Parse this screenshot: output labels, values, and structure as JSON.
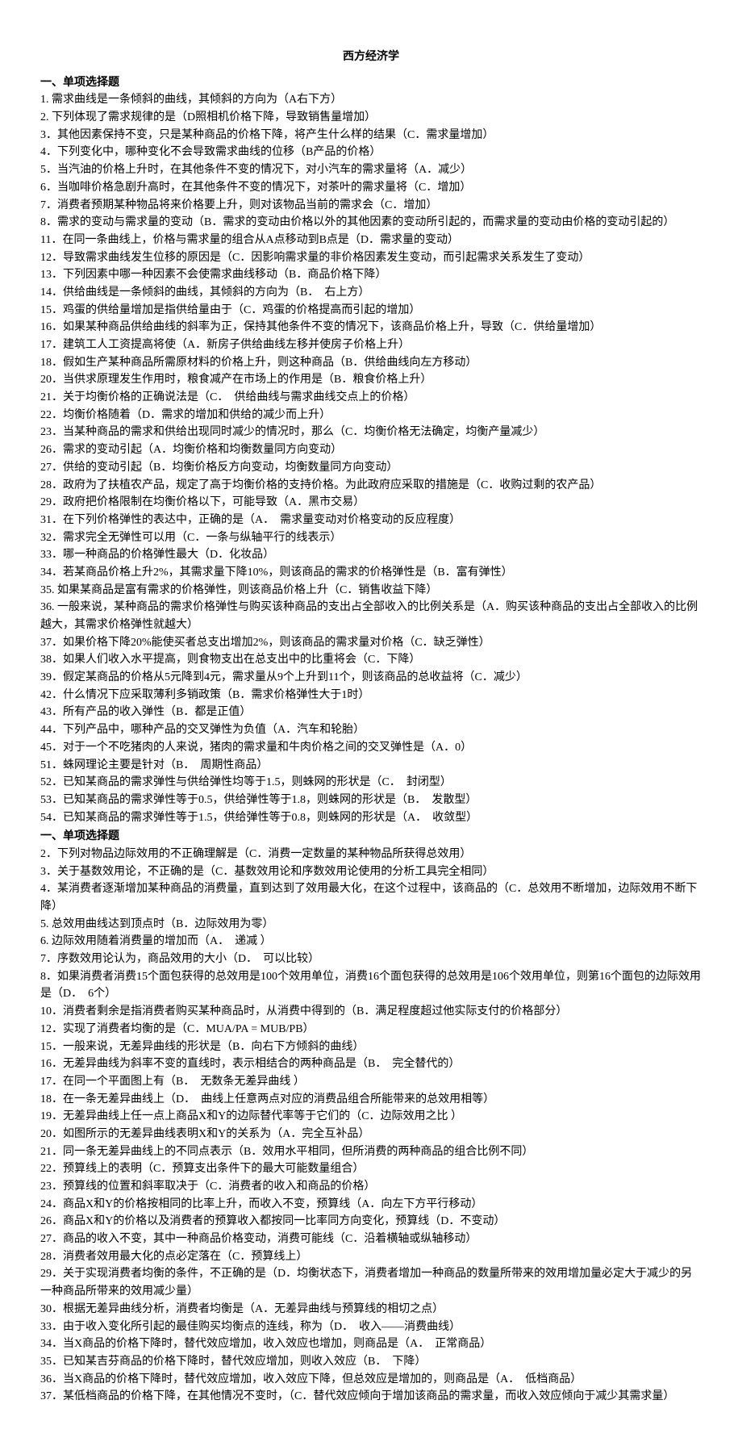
{
  "title": "西方经济学",
  "section1_heading": "一、单项选择题",
  "section1_items": [
    "1. 需求曲线是一条倾斜的曲线，其倾斜的方向为（A右下方）",
    "2. 下列体现了需求规律的是（D照相机价格下降，导致销售量增加）",
    "3．其他因素保持不变，只是某种商品的价格下降，将产生什么样的结果（C．需求量增加）",
    "4．下列变化中，哪种变化不会导致需求曲线的位移（B产品的价格）",
    "5．当汽油的价格上升时，在其他条件不变的情况下，对小汽车的需求量将（A．减少）",
    "6．当咖啡价格急剧升高时，在其他条件不变的情况下，对茶叶的需求量将（C．增加）",
    "7．消费者预期某种物品将来价格要上升，则对该物品当前的需求会（C．增加）",
    "8．需求的变动与需求量的变动（B．需求的变动由价格以外的其他因素的变动所引起的，而需求量的变动由价格的变动引起的）",
    "11．在同一条曲线上，价格与需求量的组合从A点移动到B点是（D．需求量的变动）",
    "12．导致需求曲线发生位移的原因是（C．因影响需求量的非价格因素发生变动，而引起需求关系发生了变动）",
    "13．下列因素中哪一种因素不会使需求曲线移动（B．商品价格下降）",
    "14．供给曲线是一条倾斜的曲线，其倾斜的方向为（B．　右上方）",
    "15．鸡蛋的供给量增加是指供给量由于（C．鸡蛋的价格提高而引起的增加）",
    "16．如果某种商品供给曲线的斜率为正，保持其他条件不变的情况下，该商品价格上升，导致（C．供给量增加）",
    "17．建筑工人工资提高将使（A．新房子供给曲线左移并使房子价格上升）",
    "18．假如生产某种商品所需原材料的价格上升，则这种商品（B．供给曲线向左方移动）",
    "20．当供求原理发生作用时，粮食减产在市场上的作用是（B．粮食价格上升）",
    "21．关于均衡价格的正确说法是（C．　供给曲线与需求曲线交点上的价格）",
    "22．均衡价格随着（D．需求的增加和供给的减少而上升）",
    "23．当某种商品的需求和供给出现同时减少的情况时，那么（C．均衡价格无法确定，均衡产量减少）",
    "26．需求的变动引起（A．均衡价格和均衡数量同方向变动）",
    "27．供给的变动引起（B．均衡价格反方向变动，均衡数量同方向变动）",
    "28．政府为了扶植农产品，规定了高于均衡价格的支持价格。为此政府应采取的措施是（C．收购过剩的农产品）",
    "29．政府把价格限制在均衡价格以下，可能导致（A．黑市交易）",
    "31．在下列价格弹性的表达中，正确的是（A．　需求量变动对价格变动的反应程度）",
    "32．需求完全无弹性可以用（C．一条与纵轴平行的线表示）",
    "33．哪一种商品的价格弹性最大（D．化妆品）",
    "34．若某商品价格上升2%，其需求量下降10%，则该商品的需求的价格弹性是（B．富有弹性）",
    "35. 如果某商品是富有需求的价格弹性，则该商品价格上升（C．销售收益下降）",
    "36. 一般来说，某种商品的需求价格弹性与购买该种商品的支出占全部收入的比例关系是（A．购买该种商品的支出占全部收入的比例越大，其需求价格弹性就越大）",
    "37．如果价格下降20%能使买者总支出增加2%，则该商品的需求量对价格（C．缺乏弹性）",
    "38．如果人们收入水平提高，则食物支出在总支出中的比重将会（C．下降）",
    "39．假定某商品的价格从5元降到4元，需求量从9个上升到11个，则该商品的总收益将（C．减少）",
    "42．什么情况下应采取薄利多销政策（B．需求价格弹性大于1时）",
    "43．所有产品的收入弹性（B．都是正值）",
    "44．下列产品中，哪种产品的交叉弹性为负值（A．汽车和轮胎）",
    "45．对于一个不吃猪肉的人来说，猪肉的需求量和牛肉价格之间的交叉弹性是（A．0）",
    "51．蛛网理论主要是针对（B．　周期性商品）",
    "52．已知某商品的需求弹性与供给弹性均等于1.5，则蛛网的形状是（C．　封闭型）",
    "53．已知某商品的需求弹性等于0.5，供给弹性等于1.8，则蛛网的形状是（B．　发散型）",
    "54．已知某商品的需求弹性等于1.5，供给弹性等于0.8，则蛛网的形状是（A．　收敛型）"
  ],
  "section2_heading": "一、单项选择题",
  "section2_items": [
    "2．下列对物品边际效用的不正确理解是（C．消费一定数量的某种物品所获得总效用）",
    "3．关于基数效用论，不正确的是（C．基数效用论和序数效用论使用的分析工具完全相同）",
    "4．某消费者逐渐增加某种商品的消费量，直到达到了效用最大化，在这个过程中，该商品的（C．总效用不断增加，边际效用不断下降）",
    "5. 总效用曲线达到顶点时（B．边际效用为零）",
    "6. 边际效用随着消费量的增加而（A．　递减 ）",
    "7．序数效用论认为，商品效用的大小（D．　可以比较）",
    "8．如果消费者消费15个面包获得的总效用是100个效用单位，消费16个面包获得的总效用是106个效用单位，则第16个面包的边际效用是（D．　6个）",
    "10．消费者剩余是指消费者购买某种商品时，从消费中得到的（B．满足程度超过他实际支付的价格部分）",
    "12．实现了消费者均衡的是（C．MUA/PA = MUB/PB）",
    "15．一般来说，无差异曲线的形状是（B．向右下方倾斜的曲线）",
    "16．无差异曲线为斜率不变的直线时，表示相结合的两种商品是（B．　完全替代的）",
    "17．在同一个平面图上有（B．　无数条无差异曲线 ）",
    "18．在一条无差异曲线上（D．　曲线上任意两点对应的消费品组合所能带来的总效用相等）",
    "19．无差异曲线上任一点上商品X和Y的边际替代率等于它们的（C．边际效用之比 ）",
    "20．如图所示的无差异曲线表明X和Y的关系为（A．完全互补品）",
    "21．同一条无差异曲线上的不同点表示（B．效用水平相同，但所消费的两种商品的组合比例不同）",
    "22．预算线上的表明（C．预算支出条件下的最大可能数量组合）",
    "23．预算线的位置和斜率取决于（C．消费者的收入和商品的价格）",
    "24．商品X和Y的价格按相同的比率上升，而收入不变，预算线（A．向左下方平行移动）",
    "26．商品X和Y的价格以及消费者的预算收入都按同一比率同方向变化，预算线（D．不变动）",
    "27．商品的收入不变，其中一种商品价格变动，消费可能线（C．沿着横轴或纵轴移动）",
    "28．消费者效用最大化的点必定落在（C．预算线上）",
    "29．关于实现消费者均衡的条件，不正确的是（D．均衡状态下，消费者增加一种商品的数量所带来的效用增加量必定大于减少的另一种商品所带来的效用减少量）",
    "30．根据无差异曲线分析，消费者均衡是（A．无差异曲线与预算线的相切之点）",
    "33．由于收入变化所引起的最佳购买均衡点的连线，称为（D．　收入——消费曲线）",
    "34．当X商品的价格下降时，替代效应增加，收入效应也增加，则商品是（A．　正常商品）",
    "35．已知某吉芬商品的价格下降时，替代效应增加，则收入效应（B．　下降）",
    "36．当X商品的价格下降时，替代效应增加，收入效应下降，但总效应是增加的，则商品是（A．　低档商品）",
    "37．某低档商品的价格下降，在其他情况不变时，（C．替代效应倾向于增加该商品的需求量，而收入效应倾向于减少其需求量）"
  ]
}
